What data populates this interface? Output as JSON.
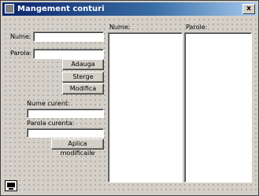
{
  "window": {
    "title": "Mangement conturi",
    "close_label": "x",
    "title_icon": "app-icon",
    "bottom_icon": "computer-icon"
  },
  "form": {
    "nume_label": "Nume:",
    "nume_value": "",
    "parola_label": "Parola:",
    "parola_value": "",
    "adauga_button": "Adauga",
    "sterge_button": "Sterge",
    "modifica_button": "Modifica",
    "nume_curent_label": "Nume curent:",
    "nume_curent_value": "",
    "parola_curenta_label": "Parola curenta:",
    "parola_curenta_value": "",
    "aplica_button": "Aplica modificaile"
  },
  "lists": {
    "nume_header": "Nume:",
    "parole_header": "Parole:",
    "nume_items": [],
    "parole_items": []
  }
}
